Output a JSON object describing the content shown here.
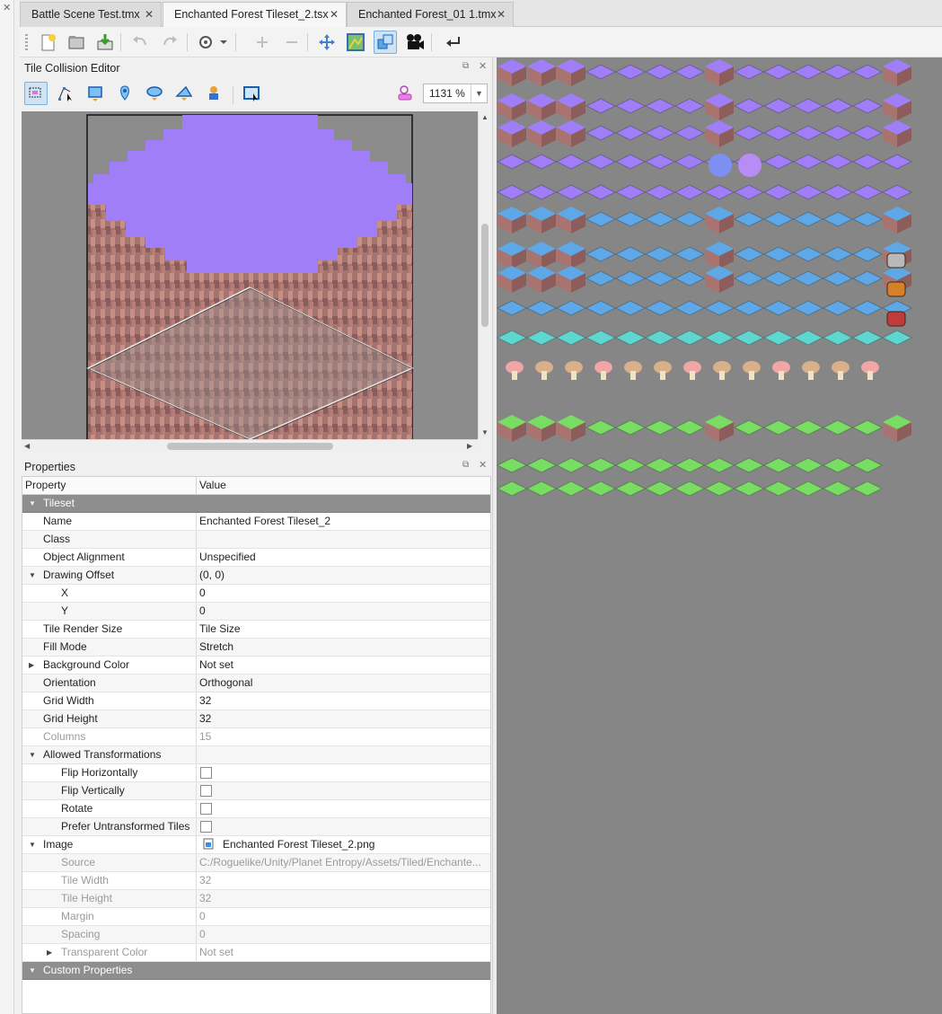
{
  "tabs": [
    {
      "label": "Battle Scene Test.tmx",
      "active": false
    },
    {
      "label": "Enchanted Forest Tileset_2.tsx",
      "active": true
    },
    {
      "label": "Enchanted Forest_01 1.tmx",
      "active": false
    }
  ],
  "toolbar": {
    "icons": [
      "new-file-icon",
      "open-file-icon",
      "save-icon",
      "undo-icon",
      "redo-icon",
      "settings-icon",
      "add-icon",
      "remove-icon",
      "move-icon",
      "terrain-icon",
      "collision-icon",
      "animation-icon",
      "return-icon"
    ]
  },
  "collision_editor": {
    "title": "Tile Collision Editor",
    "zoom": "1131 %",
    "tools": [
      "select-objects-icon",
      "edit-polygons-icon",
      "rectangle-icon",
      "point-icon",
      "ellipse-icon",
      "polygon-icon",
      "template-icon",
      "detect-bounds-icon"
    ]
  },
  "properties": {
    "title": "Properties",
    "header": {
      "property": "Property",
      "value": "Value"
    },
    "rows": [
      {
        "kind": "group",
        "label": "Tileset",
        "value": "",
        "depth": 0,
        "expand": "open"
      },
      {
        "kind": "row",
        "label": "Name",
        "value": "Enchanted Forest Tileset_2",
        "depth": 1
      },
      {
        "kind": "row",
        "label": "Class",
        "value": "",
        "depth": 1
      },
      {
        "kind": "row",
        "label": "Object Alignment",
        "value": "Unspecified",
        "depth": 1
      },
      {
        "kind": "row",
        "label": "Drawing Offset",
        "value": "(0, 0)",
        "depth": 1,
        "expand": "open"
      },
      {
        "kind": "row",
        "label": "X",
        "value": "0",
        "depth": 2
      },
      {
        "kind": "row",
        "label": "Y",
        "value": "0",
        "depth": 2
      },
      {
        "kind": "row",
        "label": "Tile Render Size",
        "value": "Tile Size",
        "depth": 1
      },
      {
        "kind": "row",
        "label": "Fill Mode",
        "value": "Stretch",
        "depth": 1
      },
      {
        "kind": "row",
        "label": "Background Color",
        "value": "Not set",
        "depth": 1,
        "expand": "closed"
      },
      {
        "kind": "row",
        "label": "Orientation",
        "value": "Orthogonal",
        "depth": 1
      },
      {
        "kind": "row",
        "label": "Grid Width",
        "value": "32",
        "depth": 1
      },
      {
        "kind": "row",
        "label": "Grid Height",
        "value": "32",
        "depth": 1
      },
      {
        "kind": "row",
        "label": "Columns",
        "value": "15",
        "depth": 1,
        "disabled": true
      },
      {
        "kind": "row",
        "label": "Allowed Transformations",
        "value": "",
        "depth": 1,
        "expand": "open"
      },
      {
        "kind": "check",
        "label": "Flip Horizontally",
        "checked": false,
        "depth": 2
      },
      {
        "kind": "check",
        "label": "Flip Vertically",
        "checked": false,
        "depth": 2
      },
      {
        "kind": "check",
        "label": "Rotate",
        "checked": false,
        "depth": 2
      },
      {
        "kind": "check",
        "label": "Prefer Untransformed Tiles",
        "checked": false,
        "depth": 2
      },
      {
        "kind": "row",
        "label": "Image",
        "value": "Enchanted Forest Tileset_2.png",
        "depth": 1,
        "expand": "open",
        "icon": "image-file-icon"
      },
      {
        "kind": "row",
        "label": "Source",
        "value": "C:/Roguelike/Unity/Planet Entropy/Assets/Tiled/Enchante...",
        "depth": 2,
        "disabled": true
      },
      {
        "kind": "row",
        "label": "Tile Width",
        "value": "32",
        "depth": 2,
        "disabled": true
      },
      {
        "kind": "row",
        "label": "Tile Height",
        "value": "32",
        "depth": 2,
        "disabled": true
      },
      {
        "kind": "row",
        "label": "Margin",
        "value": "0",
        "depth": 2,
        "disabled": true
      },
      {
        "kind": "row",
        "label": "Spacing",
        "value": "0",
        "depth": 2,
        "disabled": true
      },
      {
        "kind": "row",
        "label": "Transparent Color",
        "value": "Not set",
        "depth": 2,
        "disabled": true,
        "expand": "closed"
      },
      {
        "kind": "group",
        "label": "Custom Properties",
        "value": "",
        "depth": 0,
        "expand": "open"
      }
    ]
  },
  "colors": {
    "purple_top": "#a07ef8",
    "blue_top": "#5fa8e8",
    "cyan_top": "#5fd6d0",
    "green_top": "#78dd62",
    "dirt": "#a97470",
    "canvas_bg": "#8c8c8c"
  }
}
